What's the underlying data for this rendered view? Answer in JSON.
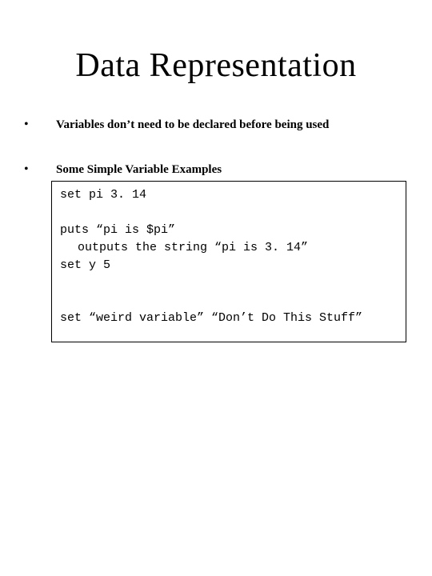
{
  "title": "Data Representation",
  "bullets": {
    "b1": "Variables don’t need to be declared before being used",
    "b2": "Some Simple Variable Examples"
  },
  "code": {
    "l1": "set pi 3. 14",
    "l2": "puts “pi is $pi”",
    "l3": "outputs the string “pi is 3. 14”",
    "l4": "set y 5",
    "l5": "set “weird variable” “Don’t Do This Stuff”"
  }
}
